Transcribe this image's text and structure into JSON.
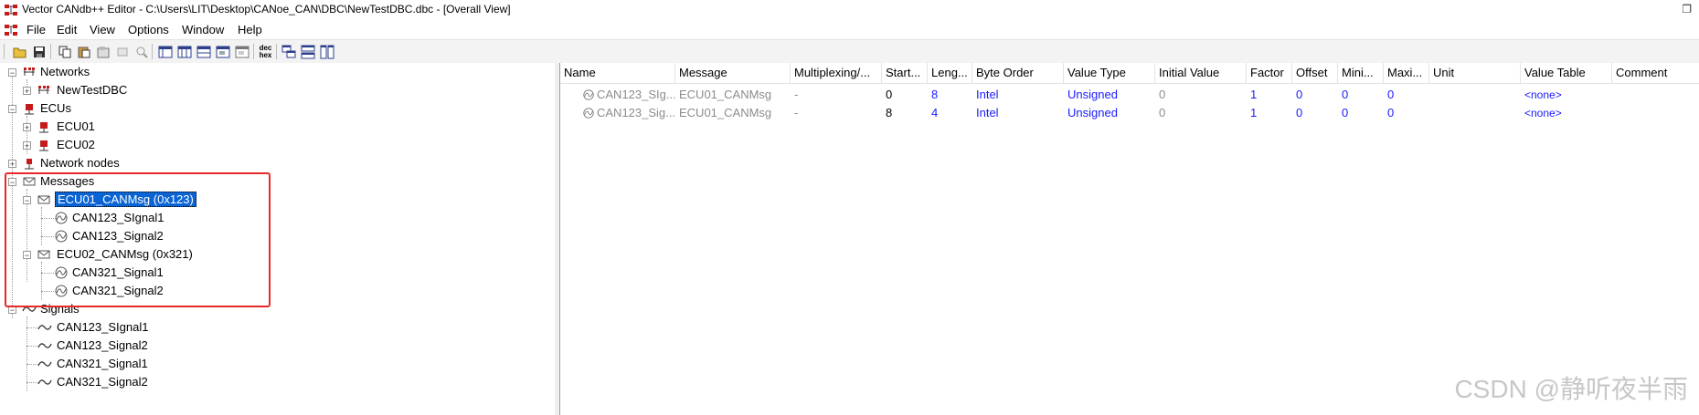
{
  "window": {
    "title": "Vector CANdb++ Editor - C:\\Users\\LIT\\Desktop\\CANoe_CAN\\DBC\\NewTestDBC.dbc - [Overall View]",
    "restore_glyph": "❐"
  },
  "menu": [
    "File",
    "Edit",
    "View",
    "Options",
    "Window",
    "Help"
  ],
  "toolbar": {
    "icons": [
      "open-icon",
      "save-icon",
      "copy-icon",
      "paste-icon",
      "new-object-icon",
      "properties-icon",
      "delete-icon",
      "view1-icon",
      "view2-icon",
      "view3-icon",
      "view4-icon",
      "view5-icon",
      "dec-hex-icon",
      "cascade-icon",
      "tile-horizontal-icon",
      "tile-vertical-icon"
    ],
    "dec_hex_label_top": "dec",
    "dec_hex_label_bottom": "hex"
  },
  "tree": {
    "networks": {
      "label": "Networks",
      "children": [
        "NewTestDBC"
      ]
    },
    "ecus": {
      "label": "ECUs",
      "children": [
        "ECU01",
        "ECU02"
      ]
    },
    "network_nodes": {
      "label": "Network nodes"
    },
    "messages": {
      "label": "Messages",
      "children": [
        {
          "label": "ECU01_CANMsg (0x123)",
          "signals": [
            "CAN123_SIgnal1",
            "CAN123_Signal2"
          ]
        },
        {
          "label": "ECU02_CANMsg (0x321)",
          "signals": [
            "CAN321_Signal1",
            "CAN321_Signal2"
          ]
        }
      ]
    },
    "signals": {
      "label": "Signals",
      "children": [
        "CAN123_SIgnal1",
        "CAN123_Signal2",
        "CAN321_Signal1",
        "CAN321_Signal2"
      ]
    }
  },
  "grid": {
    "columns": [
      "Name",
      "Message",
      "Multiplexing/...",
      "Start...",
      "Leng...",
      "Byte Order",
      "Value Type",
      "Initial Value",
      "Factor",
      "Offset",
      "Mini...",
      "Maxi...",
      "Unit",
      "Value Table",
      "Comment"
    ],
    "rows": [
      {
        "name": "CAN123_SIg...",
        "message": "ECU01_CANMsg",
        "multiplexing": "-",
        "start": "0",
        "length": "8",
        "byte_order": "Intel",
        "value_type": "Unsigned",
        "initial": "0",
        "factor": "1",
        "offset": "0",
        "min": "0",
        "max": "0",
        "unit": "",
        "value_table": "<none>",
        "comment": ""
      },
      {
        "name": "CAN123_Sig...",
        "message": "ECU01_CANMsg",
        "multiplexing": "-",
        "start": "8",
        "length": "4",
        "byte_order": "Intel",
        "value_type": "Unsigned",
        "initial": "0",
        "factor": "1",
        "offset": "0",
        "min": "0",
        "max": "0",
        "unit": "",
        "value_table": "<none>",
        "comment": ""
      }
    ]
  },
  "watermark": "CSDN @静听夜半雨",
  "colors": {
    "selection": "#0a64d4",
    "highlight_box": "#e8292a",
    "value_blue": "#1a1aff",
    "gray_text": "#8c8c8c"
  }
}
